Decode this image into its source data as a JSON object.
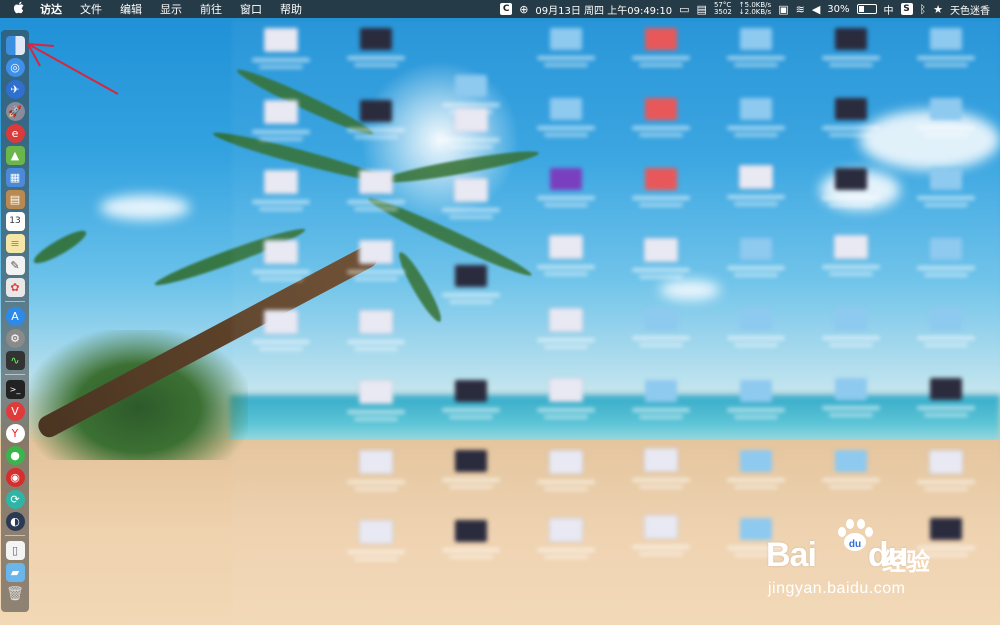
{
  "menubar": {
    "apple_icon": "apple-icon",
    "app_name": "访达",
    "menus": [
      "文件",
      "编辑",
      "显示",
      "前往",
      "窗口",
      "帮助"
    ],
    "status": {
      "clock": "09月13日 周四 上午09:49:10",
      "temp": "57°C",
      "cpu_speed": "3502",
      "net_up": "↑5.0KB/s",
      "net_down": "↓2.0KB/s",
      "battery": "30%",
      "input_method": "中",
      "user": "天色迷香"
    }
  },
  "dock": {
    "icons": [
      "finder-icon",
      "safari-icon",
      "compass-icon",
      "launchpad-icon",
      "app-red-icon",
      "android-icon",
      "preview-icon",
      "folder-app-icon",
      "calendar-icon",
      "notes-icon",
      "textedit-icon",
      "photos-icon",
      "separator",
      "appstore-icon",
      "system-preferences-icon",
      "activity-monitor-icon",
      "separator",
      "terminal-icon",
      "vivaldi-icon",
      "yandex-icon",
      "wechat-icon",
      "netease-music-icon",
      "sync-icon",
      "steam-icon",
      "separator",
      "document-icon",
      "downloads-folder-icon",
      "trash-icon"
    ],
    "calendar_day": "13"
  },
  "desktop": {
    "icon_colors": {
      "folder": "#8ec9ef",
      "red_folder": "#e8585a",
      "image": "#e9e9f3",
      "dark": "#2b2b3e",
      "purple": "#7a3fbf"
    }
  },
  "watermark": {
    "brand": "Bai",
    "brand2": "du",
    "cn": "经验",
    "url": "jingyan.baidu.com"
  }
}
